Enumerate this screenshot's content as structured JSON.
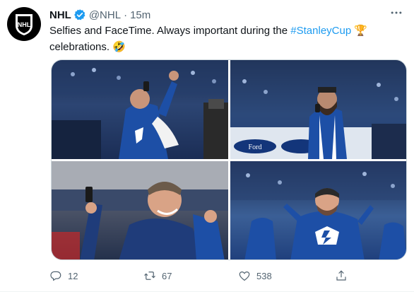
{
  "tweet": {
    "author_name": "NHL",
    "handle": "@NHL",
    "separator": "·",
    "time": "15m",
    "text_before": "Selfies and FaceTime. Always important during the ",
    "hashtag": "#StanleyCup",
    "trophy_emoji": "🏆",
    "text_after": "celebrations.",
    "laugh_emoji": "🤣"
  },
  "media": {
    "photos": [
      {
        "id": "photo-1",
        "depicts": "player-selfie-confetti"
      },
      {
        "id": "photo-2",
        "depicts": "bearded-player-phone-ford-boards"
      },
      {
        "id": "photo-3",
        "depicts": "executive-phone-selfie"
      },
      {
        "id": "photo-4",
        "depicts": "goalie-celebrating"
      }
    ]
  },
  "stats": {
    "replies": "12",
    "retweets": "67",
    "likes": "538"
  },
  "icons": {
    "avatar": "nhl-shield-logo",
    "verified": "verified-badge-icon",
    "more": "more-icon",
    "reply": "reply-icon",
    "retweet": "retweet-icon",
    "like": "like-icon",
    "share": "share-icon"
  },
  "colors": {
    "accent": "#1d9bf0",
    "secondary_text": "#536471",
    "primary_text": "#0f1419"
  }
}
